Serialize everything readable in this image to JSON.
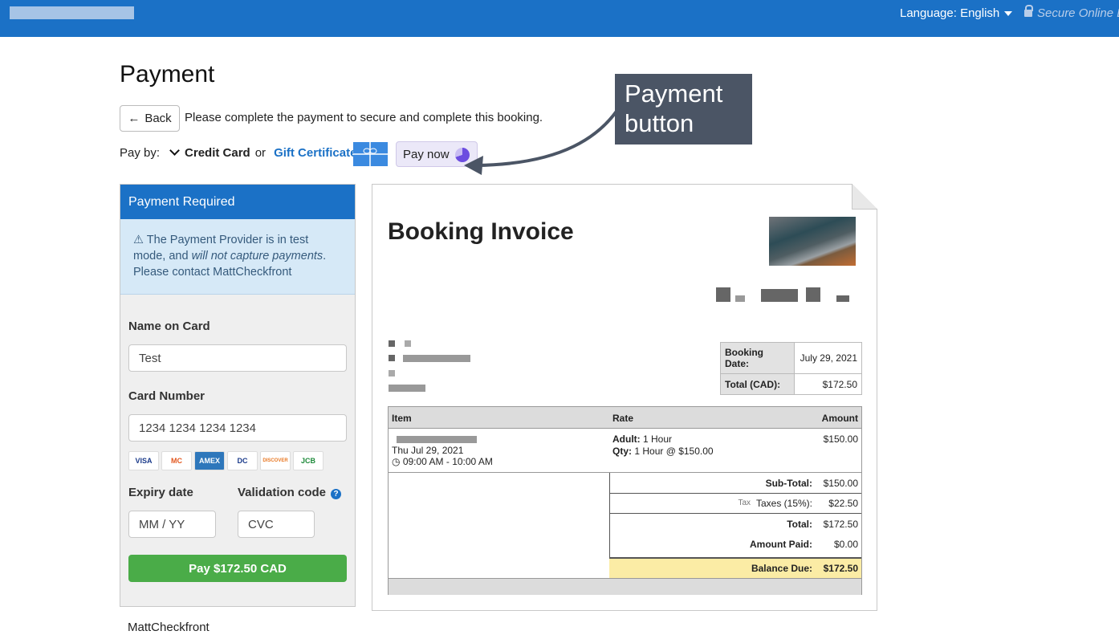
{
  "topbar": {
    "language_label": "Language: English",
    "secure_text": "Secure Online B"
  },
  "page": {
    "title": "Payment",
    "back_label": "Back",
    "intro": "Please complete the payment to secure and complete this booking.",
    "pay_by_label": "Pay by:",
    "method_selected": "Credit Card",
    "or_text": "or",
    "gift_certificate_label": "Gift Certificate",
    "pay_now_label": "Pay now"
  },
  "callout": {
    "line1": "Payment",
    "line2": "button"
  },
  "panel": {
    "header": "Payment Required",
    "alert_prefix": "The Payment Provider is in test mode, and",
    "alert_em": "will not capture payments",
    "alert_suffix": ". Please contact MattCheckfront",
    "name_label": "Name on Card",
    "name_value": "Test",
    "card_label": "Card Number",
    "card_placeholder": "1234 1234 1234 1234",
    "card_brands": [
      "VISA",
      "MC",
      "AMEX",
      "DC",
      "DISCOVER",
      "JCB"
    ],
    "expiry_label": "Expiry date",
    "expiry_placeholder": "MM / YY",
    "cvc_label": "Validation code",
    "cvc_placeholder": "CVC",
    "pay_button": "Pay $172.50 CAD"
  },
  "footer_name": "MattCheckfront",
  "invoice": {
    "title": "Booking Invoice",
    "booking_date_label": "Booking Date:",
    "booking_date": "July 29, 2021",
    "total_label": "Total (CAD):",
    "total_value": "$172.50",
    "columns": {
      "item": "Item",
      "rate": "Rate",
      "amount": "Amount"
    },
    "line": {
      "date": "Thu Jul 29, 2021",
      "time": "09:00 AM - 10:00 AM",
      "rate_adult_label": "Adult:",
      "rate_adult_value": "1 Hour",
      "rate_qty_label": "Qty:",
      "rate_qty_value": "1 Hour @ $150.00",
      "amount": "$150.00"
    },
    "subtotal_label": "Sub-Total:",
    "subtotal": "$150.00",
    "tax_tag": "Tax",
    "taxes_label": "Taxes (15%):",
    "taxes": "$22.50",
    "total2_label": "Total:",
    "total2": "$172.50",
    "paid_label": "Amount Paid:",
    "paid": "$0.00",
    "balance_label": "Balance Due:",
    "balance": "$172.50"
  }
}
